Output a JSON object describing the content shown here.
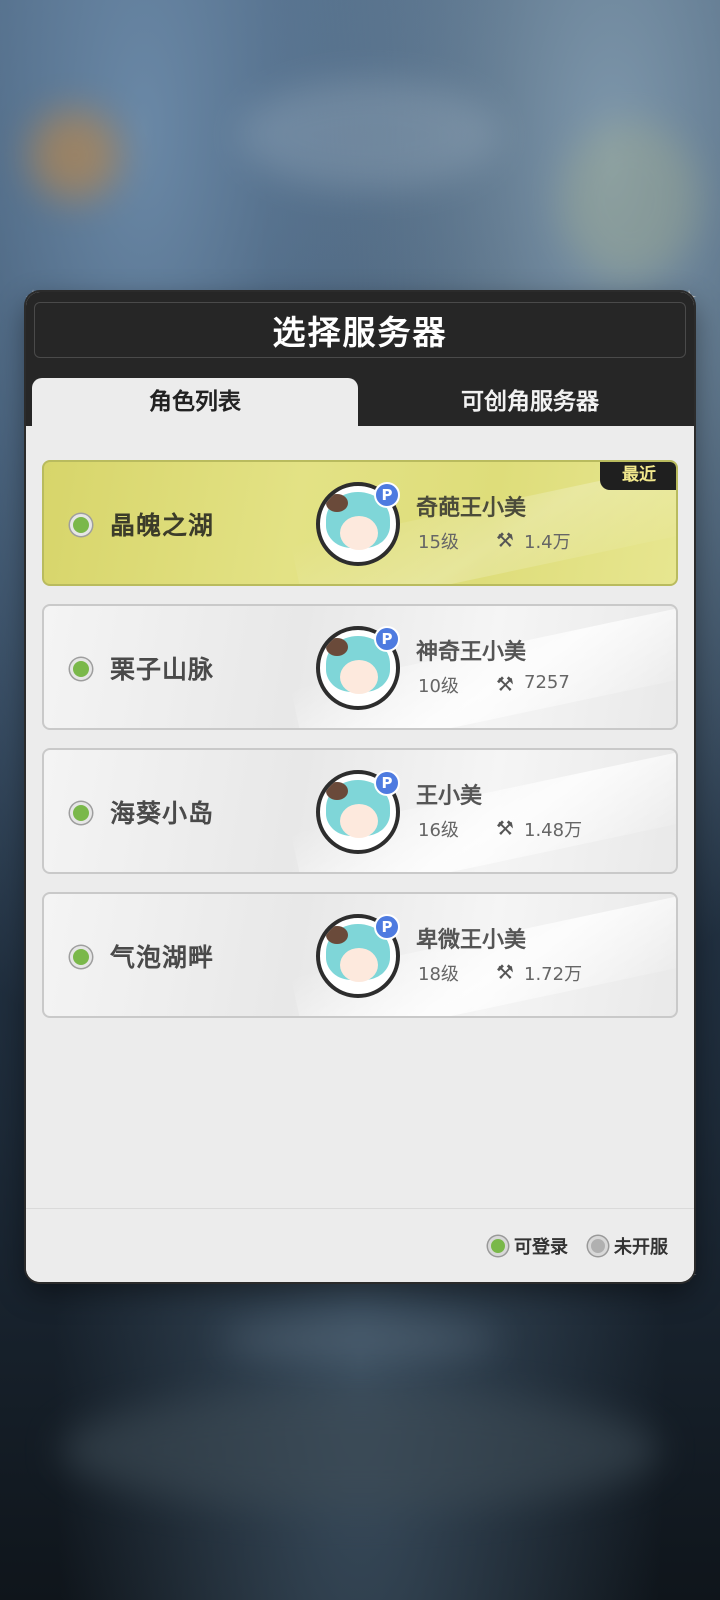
{
  "dialog": {
    "title": "选择服务器",
    "tabs": [
      {
        "label": "角色列表",
        "active": true
      },
      {
        "label": "可创角服务器",
        "active": false
      }
    ]
  },
  "servers": [
    {
      "name": "晶魄之湖",
      "status": "可登录",
      "recent": true,
      "recent_tag": "最近",
      "character": "奇葩王小美",
      "level": "15级",
      "power": "1.4万"
    },
    {
      "name": "栗子山脉",
      "status": "可登录",
      "recent": false,
      "character": "神奇王小美",
      "level": "10级",
      "power": "7257"
    },
    {
      "name": "海葵小岛",
      "status": "可登录",
      "recent": false,
      "character": "王小美",
      "level": "16级",
      "power": "1.48万"
    },
    {
      "name": "气泡湖畔",
      "status": "可登录",
      "recent": false,
      "character": "卑微王小美",
      "level": "18级",
      "power": "1.72万"
    }
  ],
  "legend": {
    "available": "可登录",
    "not_open": "未开服"
  },
  "colors": {
    "available": "#7ab84a",
    "not_open": "#b0b0b0",
    "recent_card": "#dedd7a",
    "header": "#262626"
  },
  "icons": {
    "badge": "P",
    "power": "⚒"
  }
}
